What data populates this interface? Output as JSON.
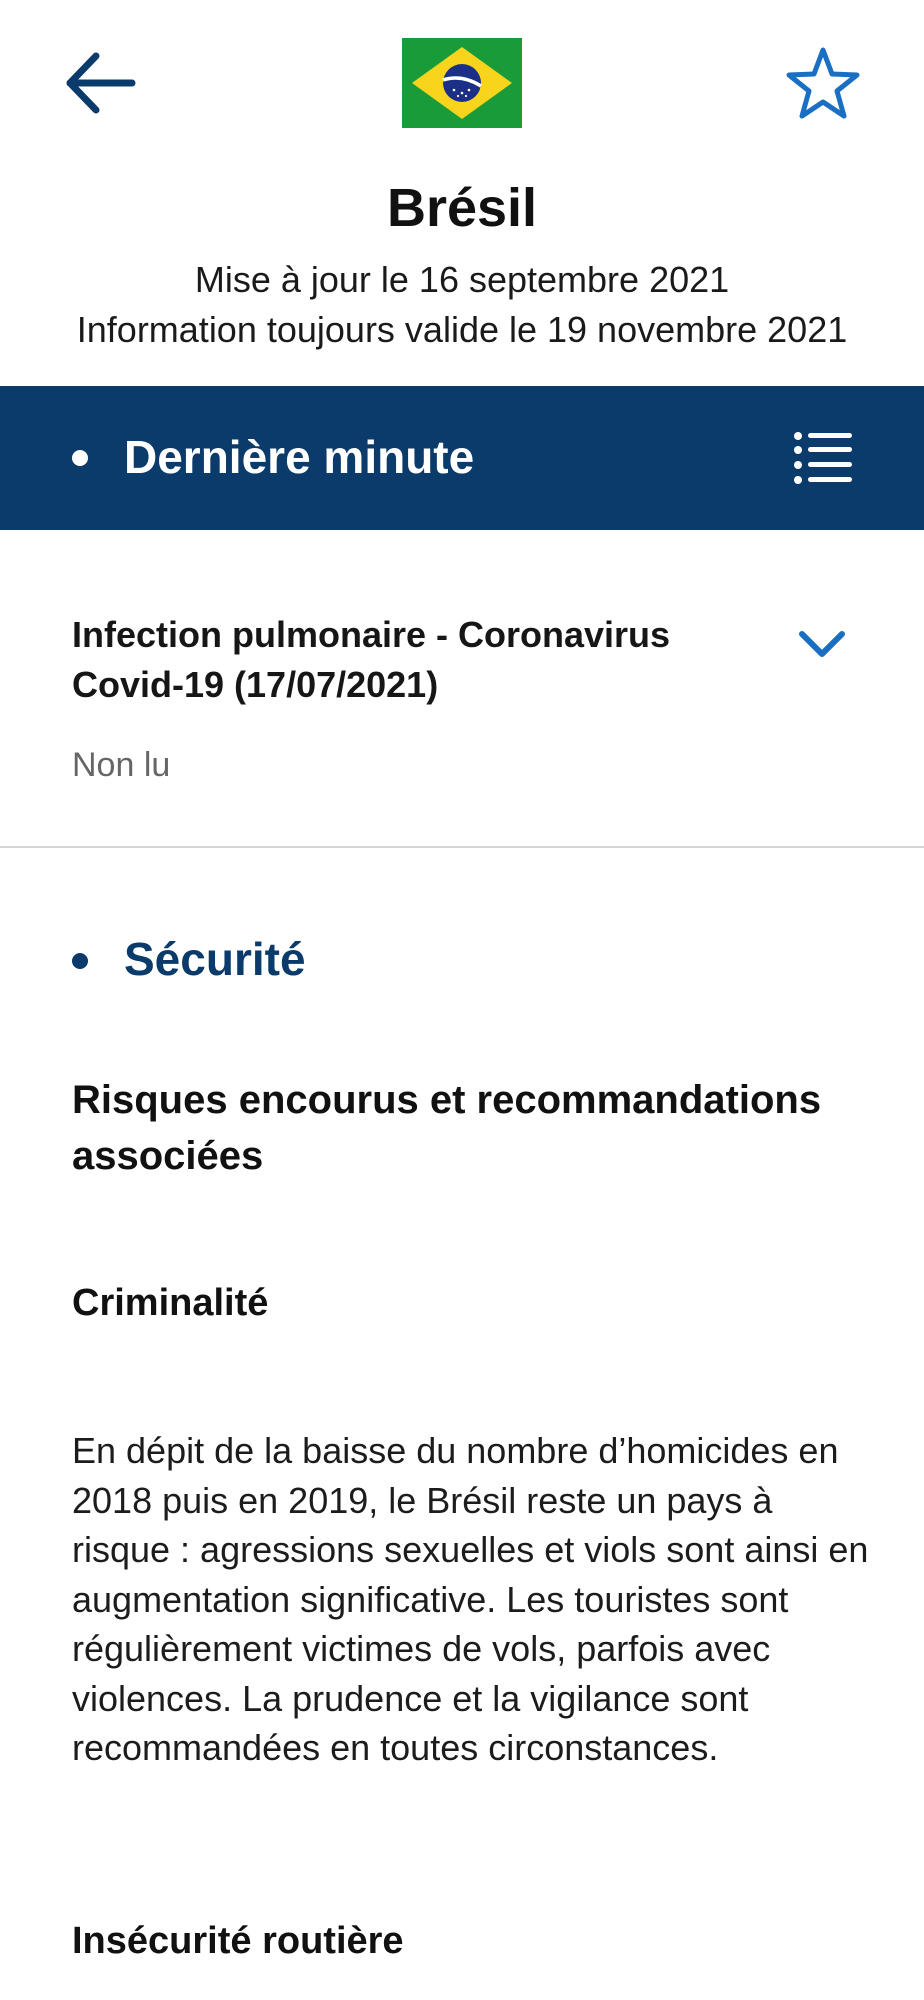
{
  "header": {
    "country": "Brésil",
    "updated": "Mise à jour le 16 septembre 2021",
    "validity": "Information toujours valide le 19 novembre 2021",
    "icons": {
      "back": "arrow-left-icon",
      "flag": "brazil-flag",
      "favorite": "star-outline-icon"
    }
  },
  "last_minute": {
    "label": "Dernière minute",
    "menu_icon": "list-menu-icon",
    "item": {
      "title": "Infection pulmonaire - Coronavirus Covid-19 (17/07/2021)",
      "status": "Non lu",
      "expand_icon": "chevron-down-icon"
    }
  },
  "security": {
    "label": "Sécurité",
    "risks_heading": "Risques encourus et recommandations associées",
    "crime_heading": "Criminalité",
    "crime_text": "En dépit de la baisse du nombre d’homicides en 2018 puis en 2019, le Brésil reste un pays à risque : agressions sexuelles et viols sont ainsi en augmentation significative. Les touristes sont régulièrement victimes de vols, parfois avec violences. La prudence et la vigilance sont recommandées en toutes circonstances.",
    "road_heading": "Insécurité routière"
  },
  "colors": {
    "primary": "#0b3b6b",
    "accent": "#1b6fc2",
    "muted": "#666666",
    "divider": "#d4d4d4"
  }
}
